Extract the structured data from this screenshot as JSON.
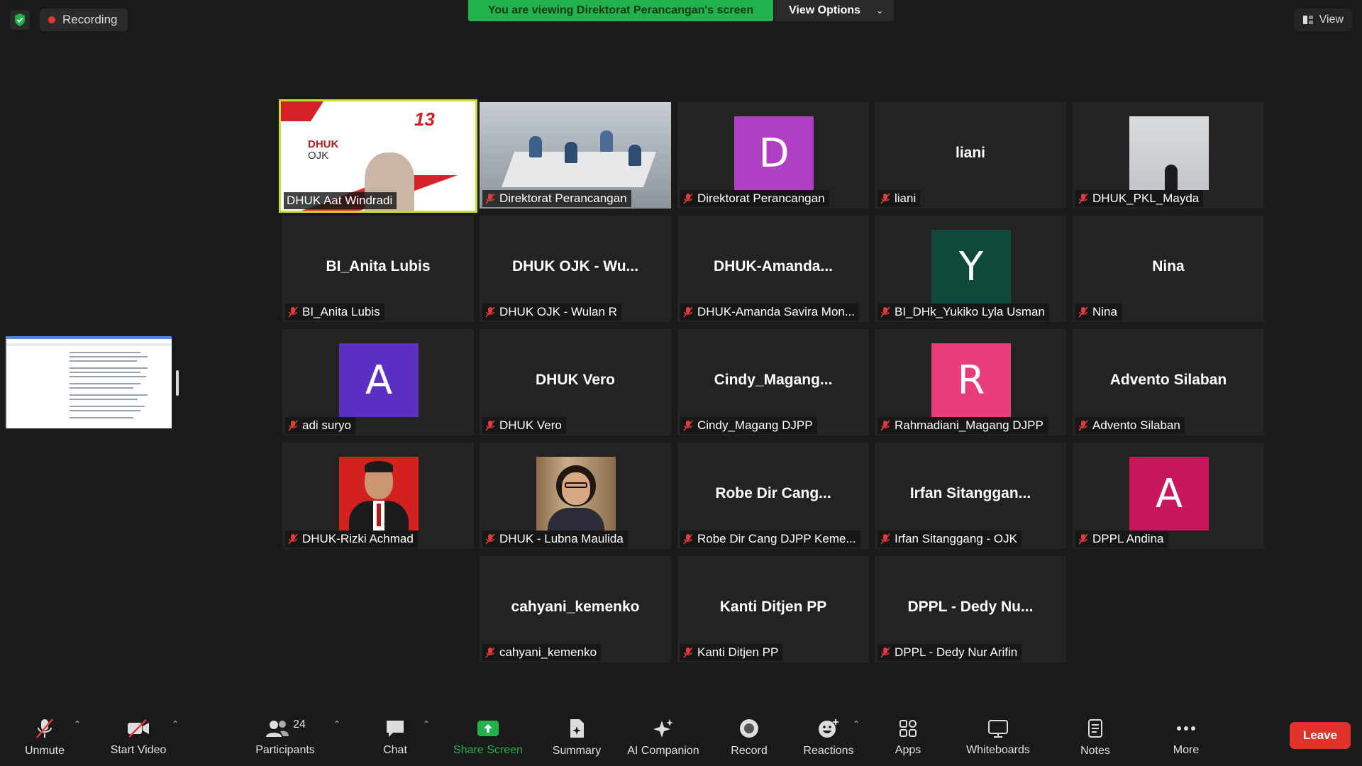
{
  "top": {
    "recording": "Recording",
    "banner": "You are viewing Direktorat Perancangan's screen",
    "view_options": "View Options",
    "view": "View"
  },
  "ojk_slide": {
    "line1": "DHUK",
    "line2": "OJK",
    "badge": "13"
  },
  "tiles": [
    {
      "label": "DHUK Aat Windradi"
    },
    {
      "label": "Direktorat Perancangan"
    },
    {
      "label": "Direktorat Perancangan",
      "avatar": "D",
      "color": "#b13fc4"
    },
    {
      "label": "liani",
      "big": "liani"
    },
    {
      "label": "DHUK_PKL_Mayda"
    },
    {
      "label": "BI_Anita Lubis",
      "big": "BI_Anita Lubis"
    },
    {
      "label": "DHUK OJK - Wulan R",
      "big": "DHUK OJK - Wu..."
    },
    {
      "label": "DHUK-Amanda Savira Mon...",
      "big": "DHUK-Amanda..."
    },
    {
      "label": "BI_DHk_Yukiko Lyla Usman",
      "avatar": "Y",
      "color": "#0d4a3c"
    },
    {
      "label": "Nina",
      "big": "Nina"
    },
    {
      "label": "adi suryo",
      "avatar": "A",
      "color": "#5b2fc2"
    },
    {
      "label": "DHUK Vero",
      "big": "DHUK Vero"
    },
    {
      "label": "Cindy_Magang DJPP",
      "big": "Cindy_Magang..."
    },
    {
      "label": "Rahmadiani_Magang DJPP",
      "avatar": "R",
      "color": "#e83d7a"
    },
    {
      "label": "Advento Silaban",
      "big": "Advento Silaban"
    },
    {
      "label": "DHUK-Rizki Achmad"
    },
    {
      "label": "DHUK - Lubna Maulida"
    },
    {
      "label": "Robe Dir Cang DJPP Keme...",
      "big": "Robe Dir Cang..."
    },
    {
      "label": "Irfan Sitanggang - OJK",
      "big": "Irfan  Sitanggan..."
    },
    {
      "label": "DPPL Andina",
      "avatar": "A",
      "color": "#c8175a"
    },
    {
      "label": "cahyani_kemenko",
      "big": "cahyani_kemenko"
    },
    {
      "label": "Kanti Ditjen PP",
      "big": "Kanti Ditjen PP"
    },
    {
      "label": "DPPL - Dedy Nur Arifin",
      "big": "DPPL - Dedy Nu..."
    }
  ],
  "toolbar": {
    "unmute": "Unmute",
    "start_video": "Start Video",
    "participants": "Participants",
    "participants_count": "24",
    "chat": "Chat",
    "share_screen": "Share Screen",
    "summary": "Summary",
    "ai_companion": "AI Companion",
    "record": "Record",
    "reactions": "Reactions",
    "apps": "Apps",
    "whiteboards": "Whiteboards",
    "notes": "Notes",
    "more": "More",
    "leave": "Leave"
  },
  "colors": {
    "banner": "#22b14c",
    "active_border": "#c9de2c",
    "leave": "#e0332b",
    "share": "#22b14c"
  },
  "icons": [
    "shield-check-icon",
    "record-dot-icon",
    "chevron-down-icon",
    "view-grid-icon",
    "mic-muted-icon",
    "video-off-icon",
    "participants-icon",
    "chat-icon",
    "share-screen-icon",
    "summary-icon",
    "ai-companion-icon",
    "record-icon",
    "reactions-icon",
    "apps-icon",
    "whiteboard-icon",
    "notes-icon",
    "more-icon"
  ]
}
